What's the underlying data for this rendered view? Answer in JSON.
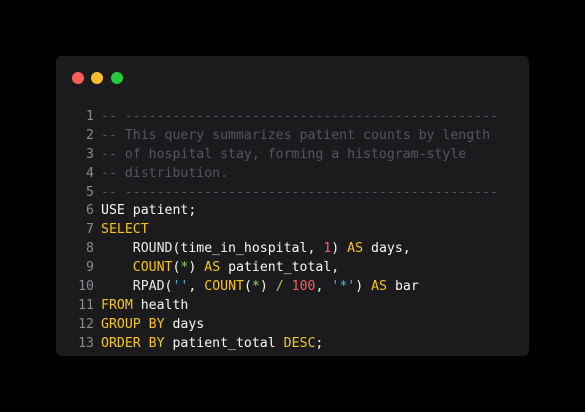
{
  "window": {
    "buttons": {
      "close_color": "#ff5f56",
      "minimize_color": "#ffbd2e",
      "maximize_color": "#27c93f"
    }
  },
  "theme": {
    "background": "#1b1b1d",
    "plain": "#f8f8f2",
    "comment": "#535663",
    "keyword": "#f5c518",
    "function": "#e8e8e8",
    "number": "#ff5c5c",
    "string": "#4fb4e3",
    "operator": "#98d65c",
    "line_number": "#8a8a8f"
  },
  "code_lines": [
    {
      "number": "1",
      "tokens": [
        {
          "text": "-- -----------------------------------------------",
          "type": "comment"
        }
      ]
    },
    {
      "number": "2",
      "tokens": [
        {
          "text": "-- This query summarizes patient counts by length",
          "type": "comment"
        }
      ]
    },
    {
      "number": "3",
      "tokens": [
        {
          "text": "-- of hospital stay, forming a histogram-style",
          "type": "comment"
        }
      ]
    },
    {
      "number": "4",
      "tokens": [
        {
          "text": "-- distribution.",
          "type": "comment"
        }
      ]
    },
    {
      "number": "5",
      "tokens": [
        {
          "text": "-- -----------------------------------------------",
          "type": "comment"
        }
      ]
    },
    {
      "number": "6",
      "tokens": [
        {
          "text": "USE patient;",
          "type": "plain"
        }
      ]
    },
    {
      "number": "7",
      "tokens": [
        {
          "text": "SELECT",
          "type": "keyword"
        }
      ]
    },
    {
      "number": "8",
      "tokens": [
        {
          "text": "    ROUND",
          "type": "function"
        },
        {
          "text": "(time_in_hospital, ",
          "type": "plain"
        },
        {
          "text": "1",
          "type": "number"
        },
        {
          "text": ") ",
          "type": "plain"
        },
        {
          "text": "AS",
          "type": "keyword"
        },
        {
          "text": " days,",
          "type": "plain"
        }
      ]
    },
    {
      "number": "9",
      "tokens": [
        {
          "text": "    ",
          "type": "plain"
        },
        {
          "text": "COUNT",
          "type": "keyword"
        },
        {
          "text": "(",
          "type": "plain"
        },
        {
          "text": "*",
          "type": "operator"
        },
        {
          "text": ") ",
          "type": "plain"
        },
        {
          "text": "AS",
          "type": "keyword"
        },
        {
          "text": " patient_total,",
          "type": "plain"
        }
      ]
    },
    {
      "number": "10",
      "tokens": [
        {
          "text": "    RPAD",
          "type": "function"
        },
        {
          "text": "(",
          "type": "plain"
        },
        {
          "text": "''",
          "type": "string"
        },
        {
          "text": ", ",
          "type": "plain"
        },
        {
          "text": "COUNT",
          "type": "keyword"
        },
        {
          "text": "(",
          "type": "plain"
        },
        {
          "text": "*",
          "type": "operator"
        },
        {
          "text": ") ",
          "type": "plain"
        },
        {
          "text": "/",
          "type": "operator"
        },
        {
          "text": " ",
          "type": "plain"
        },
        {
          "text": "100",
          "type": "number"
        },
        {
          "text": ", ",
          "type": "plain"
        },
        {
          "text": "'*'",
          "type": "string"
        },
        {
          "text": ") ",
          "type": "plain"
        },
        {
          "text": "AS",
          "type": "keyword"
        },
        {
          "text": " bar",
          "type": "plain"
        }
      ]
    },
    {
      "number": "11",
      "tokens": [
        {
          "text": "FROM",
          "type": "keyword"
        },
        {
          "text": " health",
          "type": "plain"
        }
      ]
    },
    {
      "number": "12",
      "tokens": [
        {
          "text": "GROUP BY",
          "type": "keyword"
        },
        {
          "text": " days",
          "type": "plain"
        }
      ]
    },
    {
      "number": "13",
      "tokens": [
        {
          "text": "ORDER BY",
          "type": "keyword"
        },
        {
          "text": " patient_total ",
          "type": "plain"
        },
        {
          "text": "DESC",
          "type": "keyword"
        },
        {
          "text": ";",
          "type": "plain"
        }
      ]
    }
  ]
}
